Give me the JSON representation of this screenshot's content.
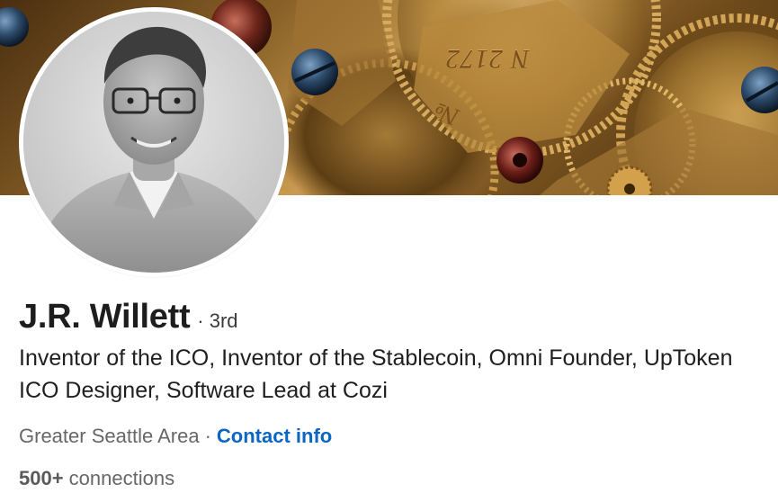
{
  "banner": {
    "engraving_main": "N 2172",
    "engraving_secondary": "№"
  },
  "profile": {
    "name": "J.R. Willett",
    "degree": "· 3rd",
    "headline": "Inventor of the ICO, Inventor of the Stablecoin, Omni Founder, UpToken ICO Designer, Software Lead at Cozi",
    "location": "Greater Seattle Area",
    "separator": "·",
    "contact_info_label": "Contact info",
    "connections_count": "500+",
    "connections_label": "connections"
  },
  "colors": {
    "link": "#0a66c2",
    "name": "#1d1d1d",
    "muted": "#676767"
  },
  "icons": [
    "banner-gears-image",
    "profile-photo"
  ]
}
